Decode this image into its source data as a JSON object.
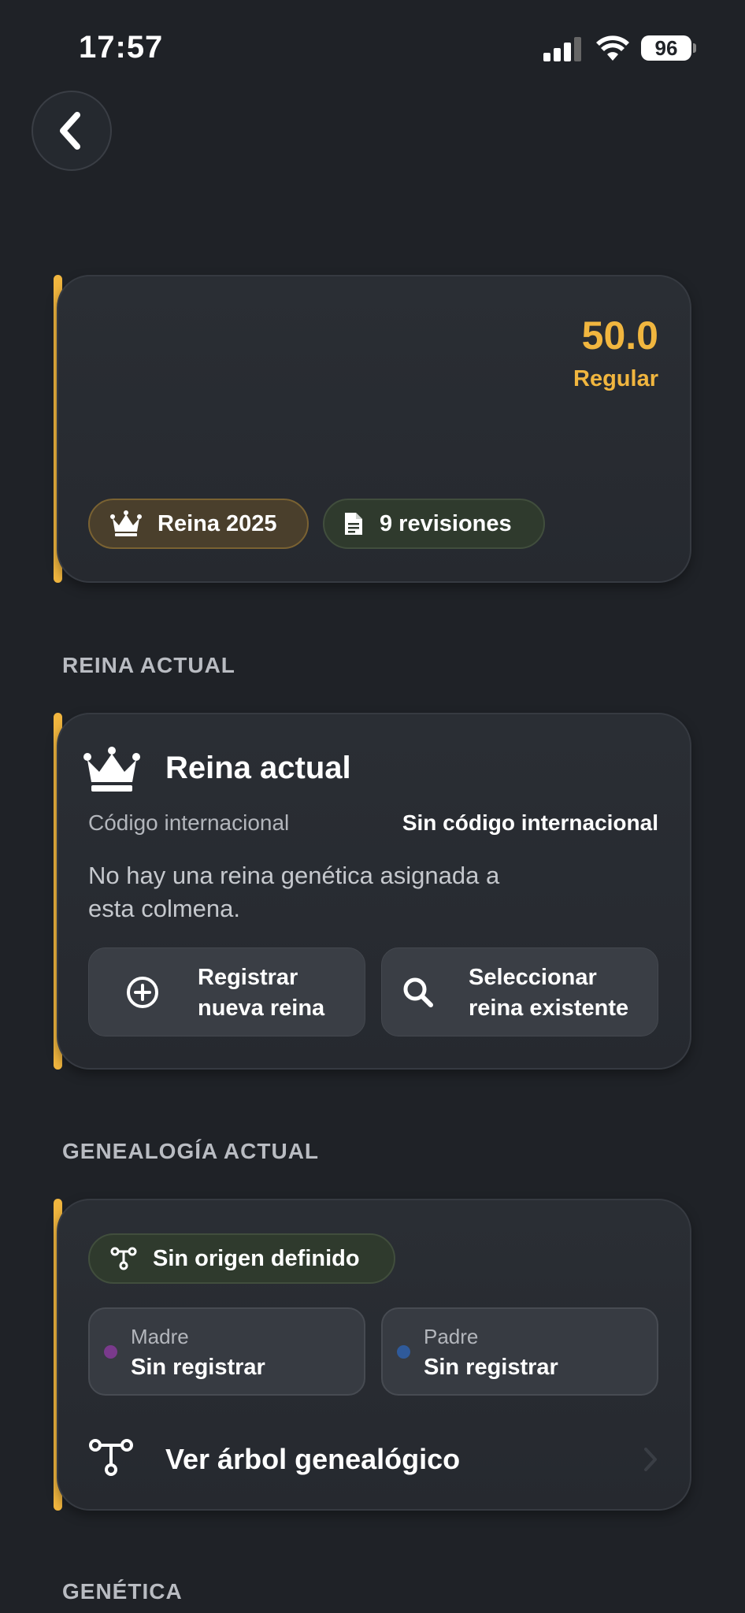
{
  "status_bar": {
    "time": "17:57",
    "battery": "96"
  },
  "summary": {
    "score": "50.0",
    "score_label": "Regular",
    "badges": [
      {
        "label": "Reina 2025",
        "icon": "crown-icon"
      },
      {
        "label": "9 revisiones",
        "icon": "document-icon"
      }
    ]
  },
  "queen_section": {
    "heading": "REINA ACTUAL",
    "title": "Reina actual",
    "code_label": "Código internacional",
    "code_value": "Sin código internacional",
    "empty_message_line1": "No hay una reina genética asignada a",
    "empty_message_line2": "esta colmena.",
    "register_line1": "Registrar",
    "register_line2": "nueva reina",
    "select_line1": "Seleccionar",
    "select_line2": "reina existente"
  },
  "genealogy_section": {
    "heading": "GENEALOGÍA ACTUAL",
    "origin_badge": "Sin origen definido",
    "mother_label": "Madre",
    "mother_value": "Sin registrar",
    "father_label": "Padre",
    "father_value": "Sin registrar",
    "tree_link": "Ver árbol genealógico"
  },
  "genetics_section": {
    "heading": "GENÉTICA"
  },
  "colors": {
    "accent": "#f1b63f",
    "background": "#1f2227",
    "mother_dot": "#7a3a8c",
    "father_dot": "#2f5a9a"
  }
}
